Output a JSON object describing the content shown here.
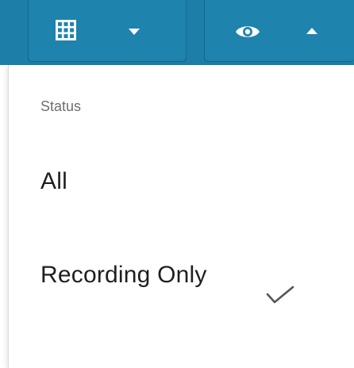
{
  "toolbar": {
    "background_color": "#1d7fa8",
    "buttons": [
      {
        "name": "grid-view-button",
        "icon": "grid-icon",
        "caret": "chevron-down-icon"
      },
      {
        "name": "visibility-filter-button",
        "icon": "eye-icon",
        "caret": "chevron-up-icon"
      }
    ]
  },
  "menu": {
    "header": "Status",
    "items": [
      {
        "label": "All",
        "selected": false
      },
      {
        "label": "Recording Only",
        "selected": true,
        "indicator": "check-icon"
      }
    ]
  }
}
